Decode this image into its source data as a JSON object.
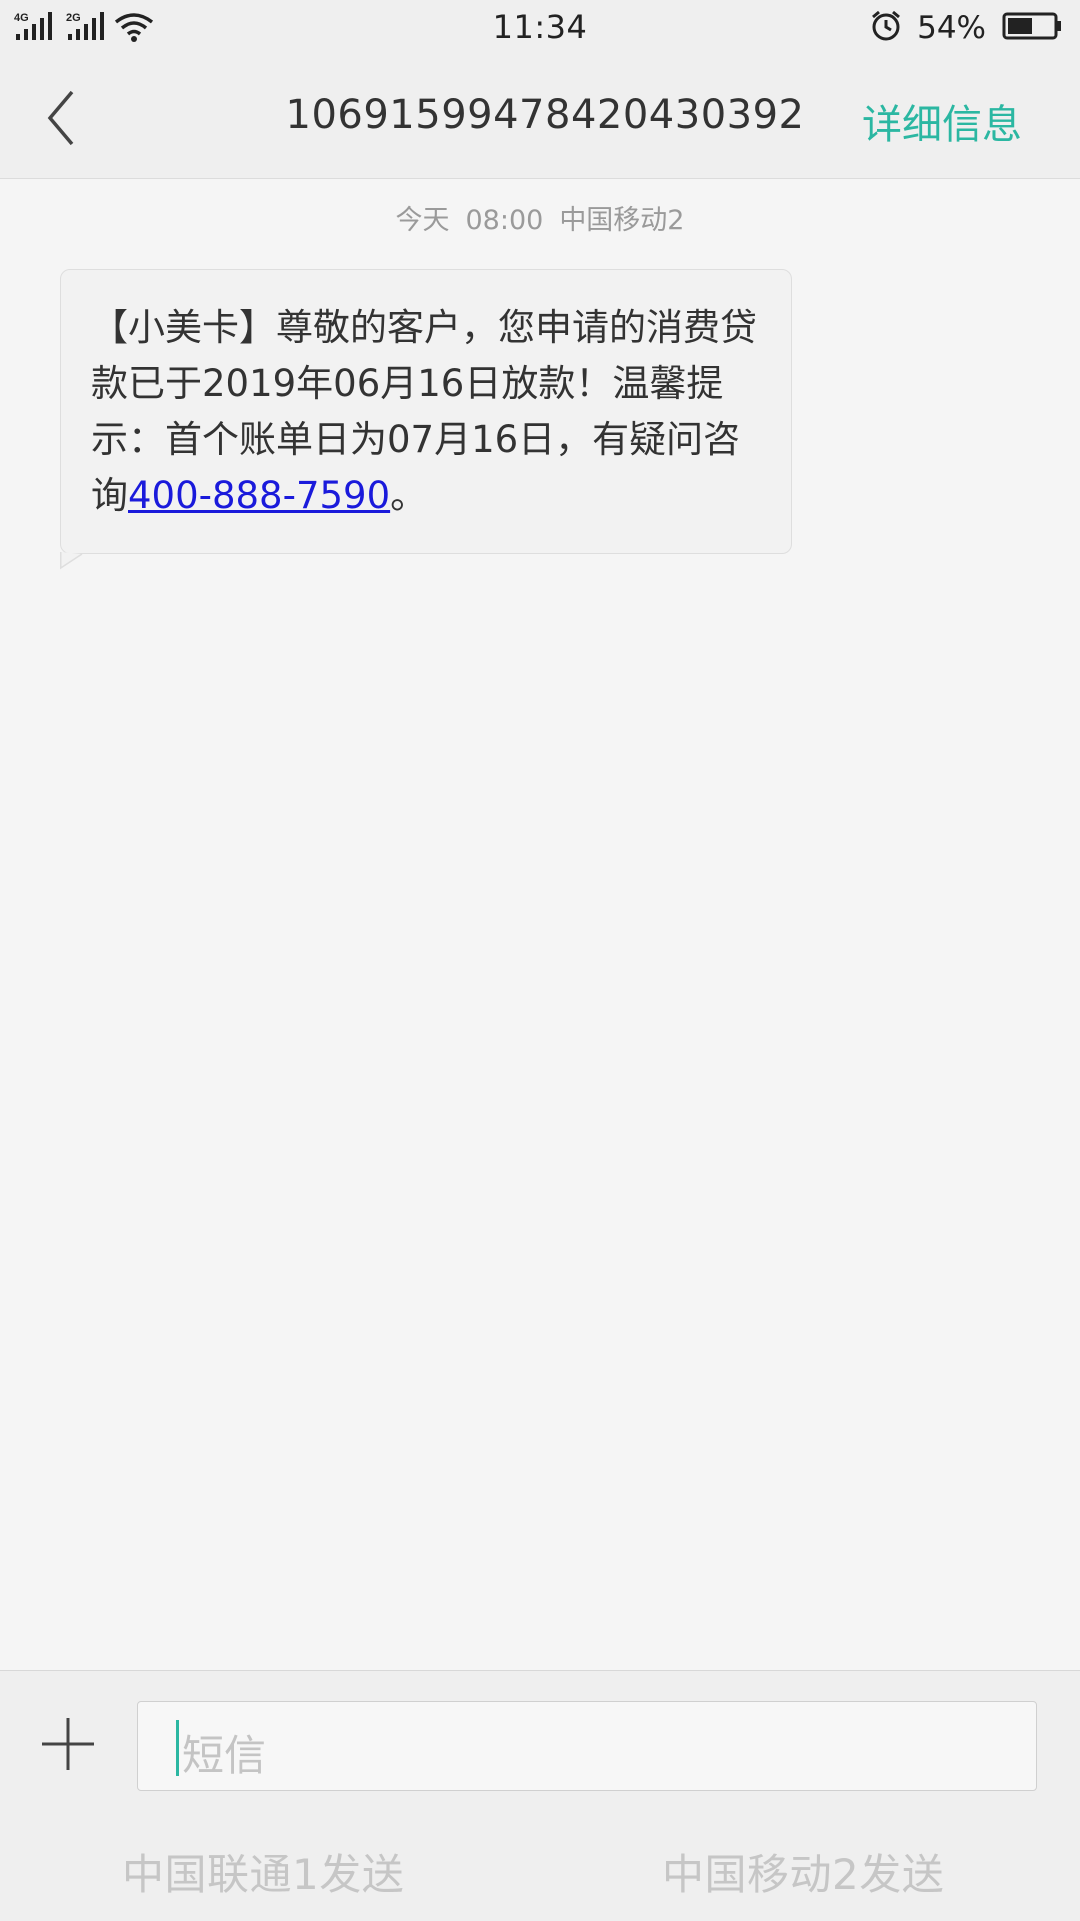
{
  "status_bar": {
    "sim1_network": "4G",
    "sim2_network": "2G",
    "time": "11:34",
    "battery_percent": "54%",
    "battery_level": 0.54,
    "icons": [
      "signal-icon",
      "wifi-icon",
      "alarm-icon",
      "battery-icon"
    ]
  },
  "header": {
    "title": "1069159947842043039 2",
    "detail_label": "详细信息",
    "accent_color": "#2bb7a2"
  },
  "message_meta": {
    "date": "今天",
    "time": "08:00",
    "carrier": "中国移动2"
  },
  "message": {
    "text_before": "【小美卡】尊敬的客户，您申请的消费贷款已于2019年06月16日放款！温馨提示：首个账单日为07月16日，有疑问咨询",
    "phone_link": "400-888-7590",
    "text_after": "。",
    "link_color": "#1a1adb"
  },
  "composer": {
    "placeholder": "短信",
    "send_sim1_label": "中国联通1发送",
    "send_sim2_label": "中国移动2发送"
  }
}
